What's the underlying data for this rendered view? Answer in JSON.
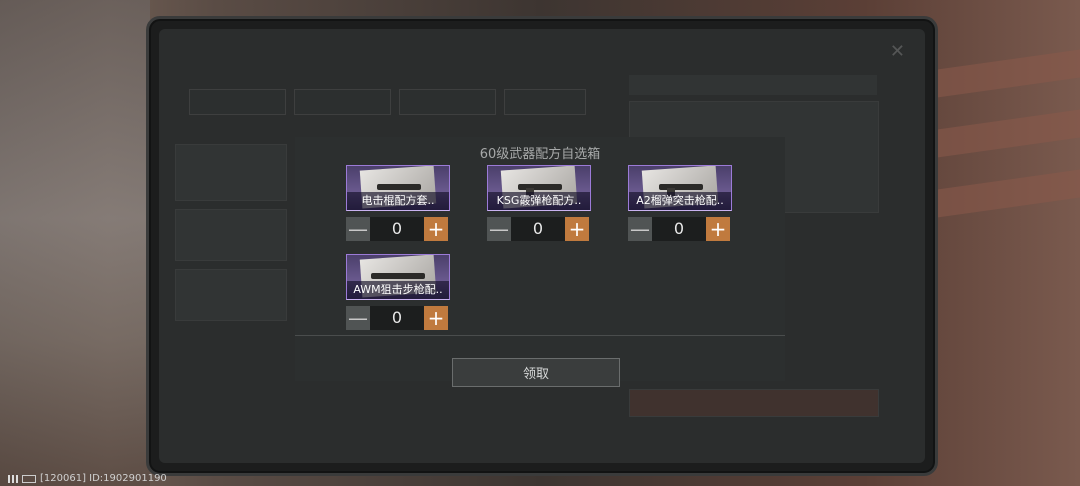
{
  "modal": {
    "title": "60级武器配方自选箱",
    "items": [
      {
        "label": "电击棍配方套..",
        "quantity": "0",
        "minus": "—",
        "plus": "+"
      },
      {
        "label": "KSG霰弹枪配方..",
        "quantity": "0",
        "minus": "—",
        "plus": "+"
      },
      {
        "label": "A2榴弹突击枪配..",
        "quantity": "0",
        "minus": "—",
        "plus": "+"
      },
      {
        "label": "AWM狙击步枪配..",
        "quantity": "0",
        "minus": "—",
        "plus": "+"
      }
    ],
    "claim_label": "领取"
  },
  "status": {
    "text": "[120061] ID:1902901190"
  },
  "colors": {
    "accent": "#c07a3e",
    "card_border": "#9c7bd8"
  }
}
